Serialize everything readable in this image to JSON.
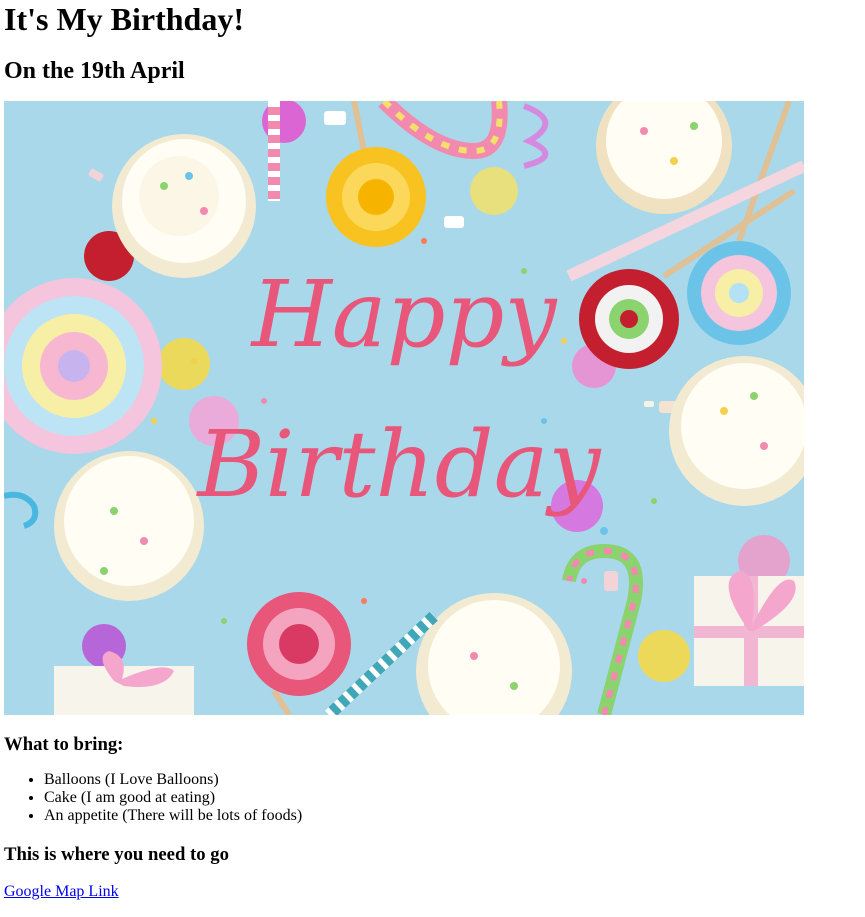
{
  "page": {
    "title": "It's My Birthday!",
    "subtitle": "On the 19th April",
    "hero_text_line1": "Happy",
    "hero_text_line2": "Birthday",
    "bring_heading": "What to bring:",
    "bring_items": [
      "Balloons (I Love Balloons)",
      "Cake (I am good at eating)",
      "An appetite (There will be lots of foods)"
    ],
    "go_heading": "This is where you need to go",
    "map_link_label": "Google Map Link"
  },
  "colors": {
    "background": "#a9d8ea",
    "script_text": "#e8567a",
    "link": "#0000EE"
  }
}
